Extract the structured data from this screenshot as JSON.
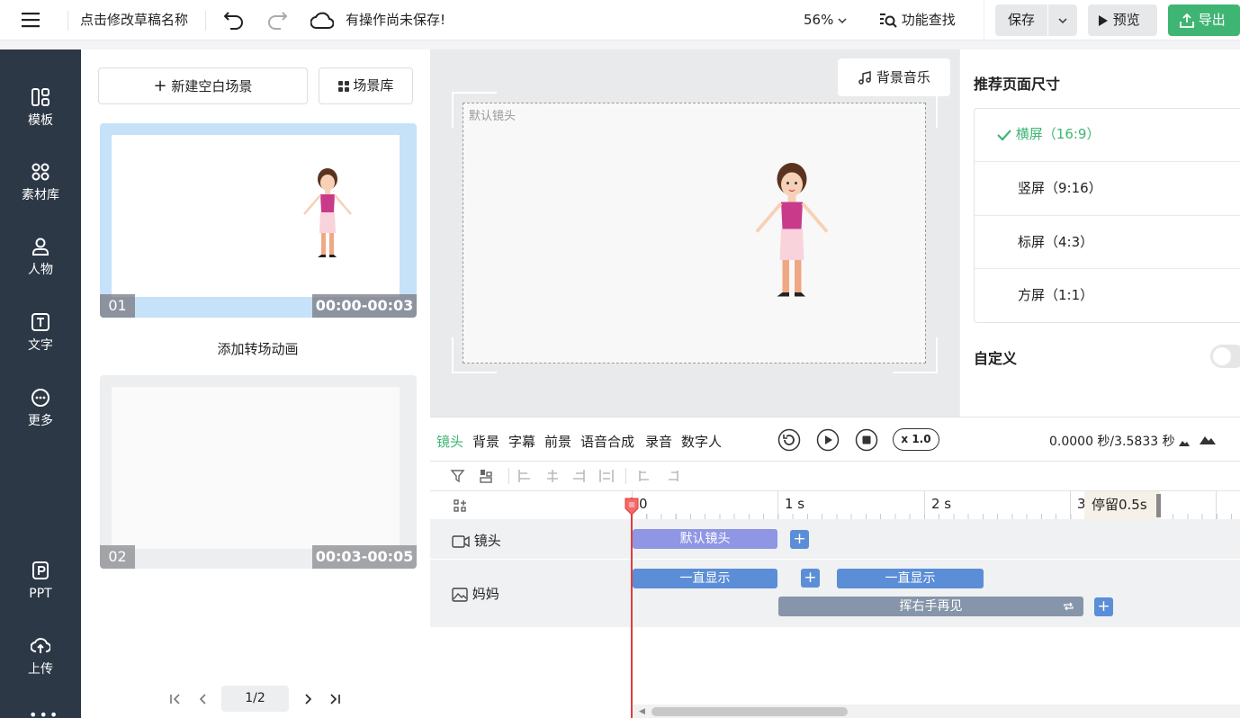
{
  "topbar": {
    "draft_name": "点击修改草稿名称",
    "save_status": "有操作尚未保存!",
    "zoom": "56%",
    "search_label": "功能查找",
    "save_label": "保存",
    "preview_label": "预览",
    "export_label": "导出"
  },
  "nav": {
    "items": [
      {
        "label": "模板",
        "icon": "template-icon"
      },
      {
        "label": "素材库",
        "icon": "material-icon"
      },
      {
        "label": "人物",
        "icon": "person-icon"
      },
      {
        "label": "文字",
        "icon": "text-icon"
      },
      {
        "label": "更多",
        "icon": "more-icon"
      },
      {
        "label": "PPT",
        "icon": "ppt-icon"
      },
      {
        "label": "上传",
        "icon": "upload-icon"
      }
    ]
  },
  "scenes": {
    "new_scene_label": "新建空白场景",
    "library_label": "场景库",
    "items": [
      {
        "index": "01",
        "range": "00:00-00:03"
      },
      {
        "index": "02",
        "range": "00:03-00:05"
      }
    ],
    "transition_label": "添加转场动画",
    "page_indicator": "1/2"
  },
  "canvas": {
    "music_label": "背景音乐",
    "camera_label": "默认镜头"
  },
  "right_panel": {
    "title": "推荐页面尺寸",
    "sizes": [
      {
        "label": "横屏（16:9）",
        "selected": true
      },
      {
        "label": "竖屏（9:16）",
        "selected": false
      },
      {
        "label": "标屏（4:3）",
        "selected": false
      },
      {
        "label": "方屏（1:1）",
        "selected": false
      }
    ],
    "custom_label": "自定义",
    "accent": "#3fb574"
  },
  "timeline": {
    "tabs": [
      "镜头",
      "背景",
      "字幕",
      "前景",
      "语音合成",
      "录音",
      "数字人"
    ],
    "active_tab": "镜头",
    "speed": "x 1.0",
    "time_display": "0.0000 秒/3.5833 秒",
    "ruler": [
      "0",
      "1 s",
      "2 s",
      "3"
    ],
    "pause_label": "停留0.5s",
    "tracks": [
      {
        "label": "镜头",
        "icon": "camera-icon"
      },
      {
        "label": "妈妈",
        "icon": "image-icon"
      }
    ],
    "clips": {
      "camera": "默认镜头",
      "show_1": "一直显示",
      "show_2": "一直显示",
      "wave": "挥右手再见"
    },
    "colors": {
      "camera_clip": "#8f96e4",
      "show_clip": "#5b8ed6",
      "action_clip": "#8695a9",
      "playhead": "#e23d3d"
    }
  }
}
